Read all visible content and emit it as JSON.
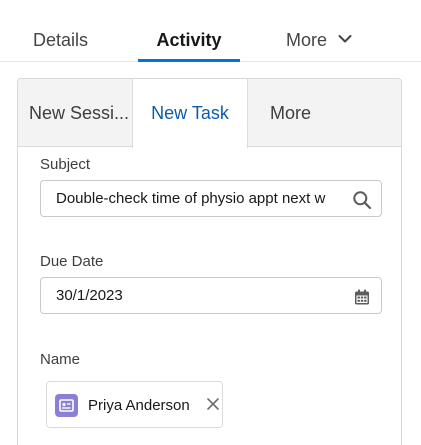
{
  "top_tabs": {
    "details": "Details",
    "activity": "Activity",
    "more": "More"
  },
  "sub_tabs": {
    "new_session": "New Sessi...",
    "new_task": "New Task",
    "more": "More"
  },
  "form": {
    "subject": {
      "label": "Subject",
      "value": "Double-check time of physio appt next w"
    },
    "due_date": {
      "label": "Due Date",
      "value": "30/1/2023"
    },
    "name": {
      "label": "Name",
      "selected": "Priya Anderson"
    }
  },
  "colors": {
    "active_tab_underline": "#0176d3",
    "active_subtab_text": "#0b5cab",
    "contact_icon": "#8b7fd6"
  },
  "icons": [
    "chevron-down-icon",
    "search-icon",
    "calendar-icon",
    "contact-icon",
    "close-icon"
  ]
}
